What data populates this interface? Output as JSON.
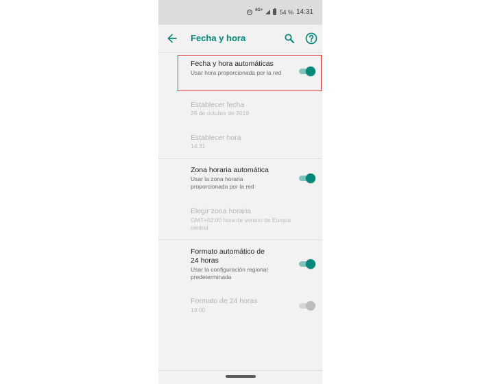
{
  "status_bar": {
    "network": "4G+",
    "battery": "54 %",
    "time": "14:31"
  },
  "toolbar": {
    "title": "Fecha y hora",
    "back_icon": "arrow-back-icon",
    "search_icon": "search-icon",
    "help_icon": "help-icon",
    "accent_color": "#00877a"
  },
  "settings": [
    {
      "title": "Fecha y hora automáticas",
      "summary": "Usar hora proporcionada por la red",
      "enabled": true,
      "switch_on": true,
      "highlighted": true
    },
    {
      "title": "Establecer fecha",
      "summary": "26 de octubre de 2019",
      "enabled": false
    },
    {
      "title": "Establecer hora",
      "summary": "14:31",
      "enabled": false
    },
    {
      "title": "Zona horaria automática",
      "summary": "Usar la zona horaria proporcionada por la red",
      "enabled": true,
      "switch_on": true
    },
    {
      "title": "Elegir zona horaria",
      "summary": "GMT+02:00 hora de verano de Europa central",
      "enabled": false
    },
    {
      "title": "Formato automático de 24 horas",
      "summary": "Usar la configuración regional predeterminada",
      "enabled": true,
      "switch_on": true
    },
    {
      "title": "Formato de 24 horas",
      "summary": "13:00",
      "enabled": false,
      "switch_on": true,
      "switch_disabled": true
    }
  ],
  "highlight_color": "#e0312f"
}
